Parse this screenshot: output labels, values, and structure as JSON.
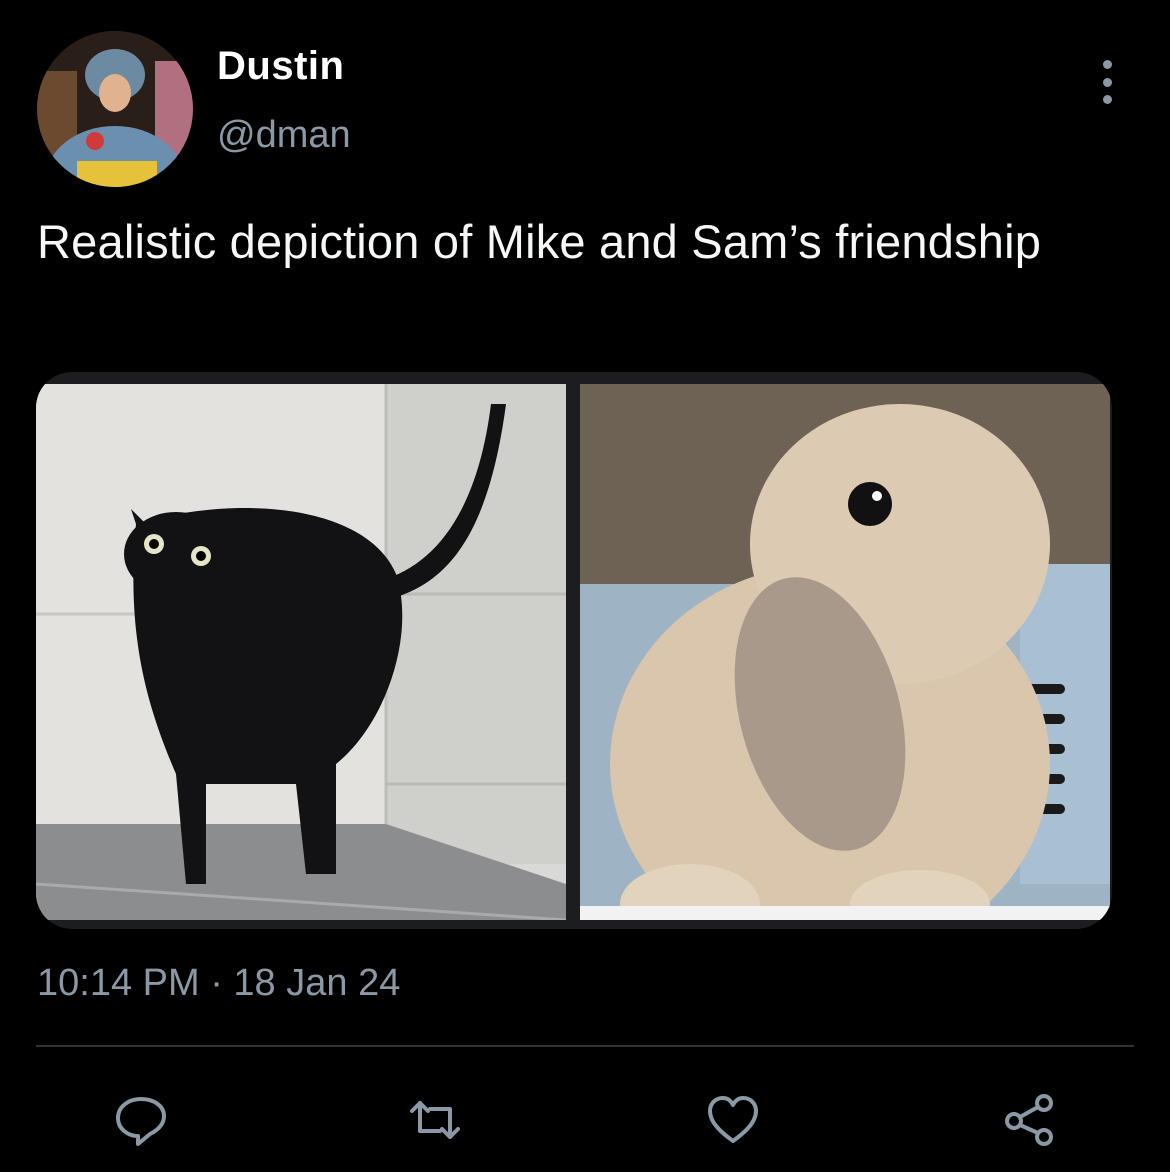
{
  "author": {
    "display_name": "Dustin",
    "handle": "@dman"
  },
  "tweet": {
    "text": "Realistic depiction of Mike and Sam’s friendship",
    "timestamp": "10:14 PM · 18 Jan 24"
  },
  "icons": {
    "more": "more-vertical-icon",
    "reply": "reply-icon",
    "retweet": "retweet-icon",
    "like": "heart-icon",
    "share": "share-icon"
  },
  "colors": {
    "background": "#000000",
    "secondary_text": "#8b98a5",
    "divider": "#2f3336"
  }
}
